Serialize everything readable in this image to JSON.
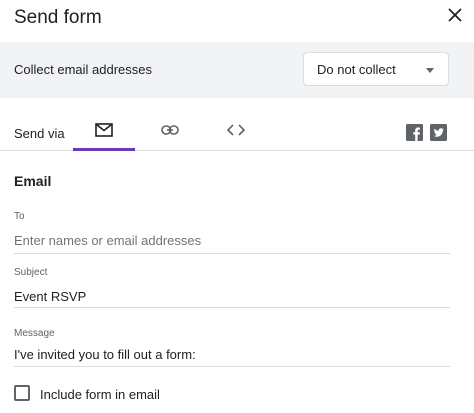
{
  "dialog": {
    "title": "Send form",
    "close_icon": "close-icon"
  },
  "collect": {
    "label": "Collect email addresses",
    "selected": "Do not collect"
  },
  "send_via": {
    "label": "Send via",
    "tabs": [
      {
        "icon": "email-icon",
        "active": true
      },
      {
        "icon": "link-icon",
        "active": false
      },
      {
        "icon": "embed-code-icon",
        "active": false
      }
    ],
    "social": [
      "facebook-icon",
      "twitter-icon"
    ]
  },
  "email": {
    "section_title": "Email",
    "to": {
      "label": "To",
      "value": "",
      "placeholder": "Enter names or email addresses"
    },
    "subject": {
      "label": "Subject",
      "value": "Event RSVP"
    },
    "message": {
      "label": "Message",
      "value": "I've invited you to fill out a form:"
    },
    "include_form": {
      "label": "Include form in email",
      "checked": false
    }
  },
  "colors": {
    "accent": "#673ab7",
    "panel_bg": "#f1f3f4",
    "divider": "#dadce0",
    "icon": "#5f6368",
    "text": "#202124"
  }
}
